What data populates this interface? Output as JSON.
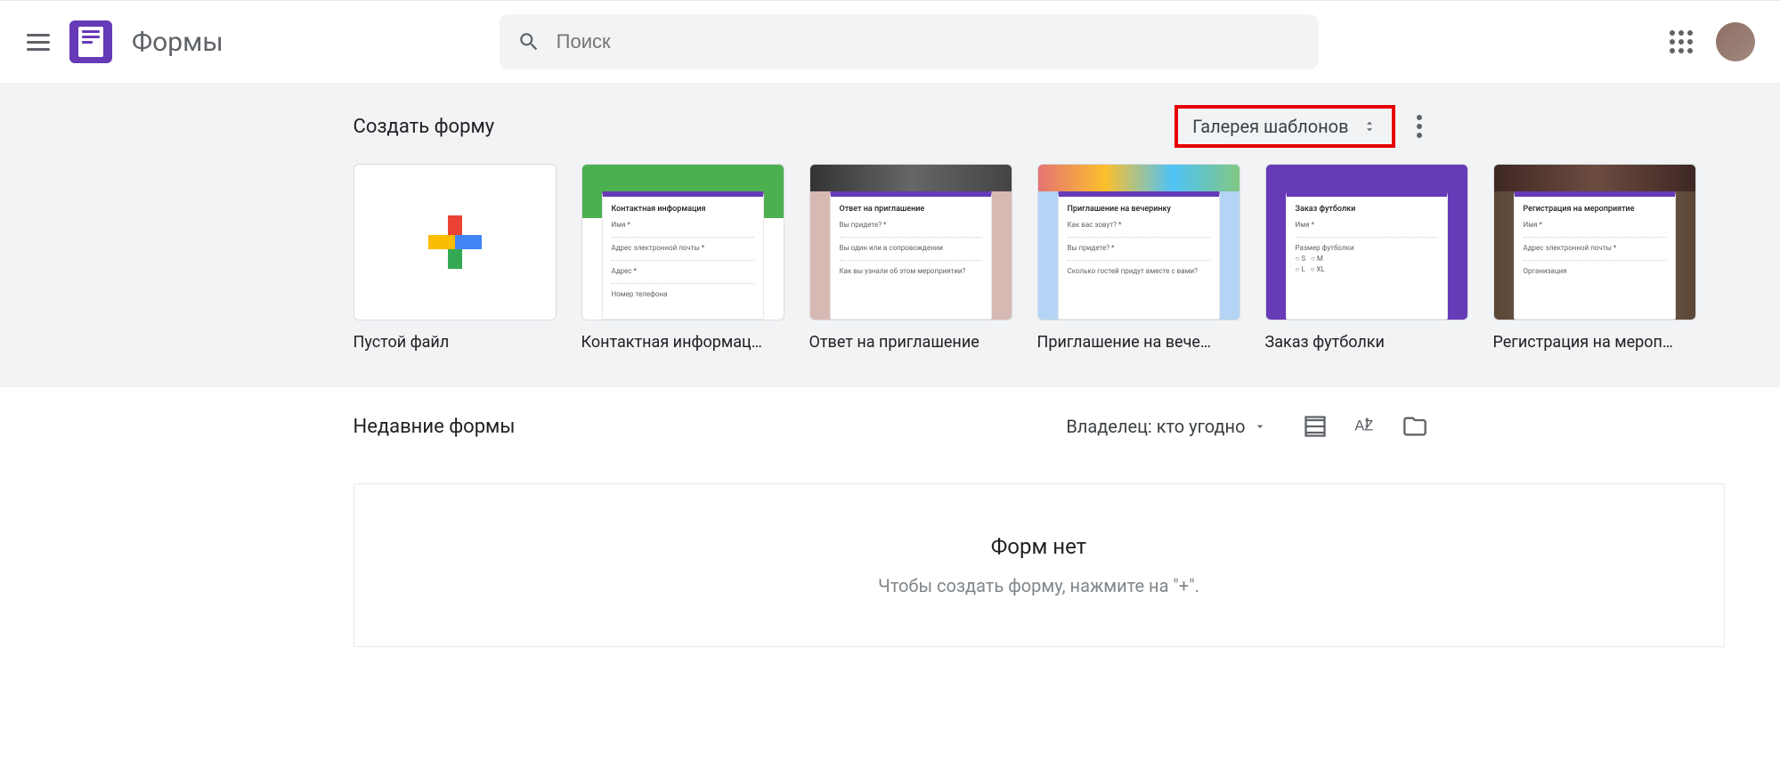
{
  "app": {
    "title": "Формы"
  },
  "search": {
    "placeholder": "Поиск"
  },
  "templates": {
    "section_title": "Создать форму",
    "gallery_button": "Галерея шаблонов",
    "items": [
      {
        "label": "Пустой файл",
        "thumb_kind": "blank"
      },
      {
        "label": "Контактная информац…",
        "thumb_kind": "contact",
        "form_title": "Контактная информация"
      },
      {
        "label": "Ответ на приглашение",
        "thumb_kind": "rsvp",
        "form_title": "Ответ на приглашение"
      },
      {
        "label": "Приглашение на вече…",
        "thumb_kind": "party",
        "form_title": "Приглашение на вечеринку"
      },
      {
        "label": "Заказ футболки",
        "thumb_kind": "tshirt",
        "form_title": "Заказ футболки"
      },
      {
        "label": "Регистрация на мероп…",
        "thumb_kind": "event",
        "form_title": "Регистрация на мероприятие"
      }
    ]
  },
  "recent": {
    "section_title": "Недавние формы",
    "owner_filter": "Владелец: кто угодно",
    "empty_title": "Форм нет",
    "empty_subtitle": "Чтобы создать форму, нажмите на \"+\"."
  }
}
